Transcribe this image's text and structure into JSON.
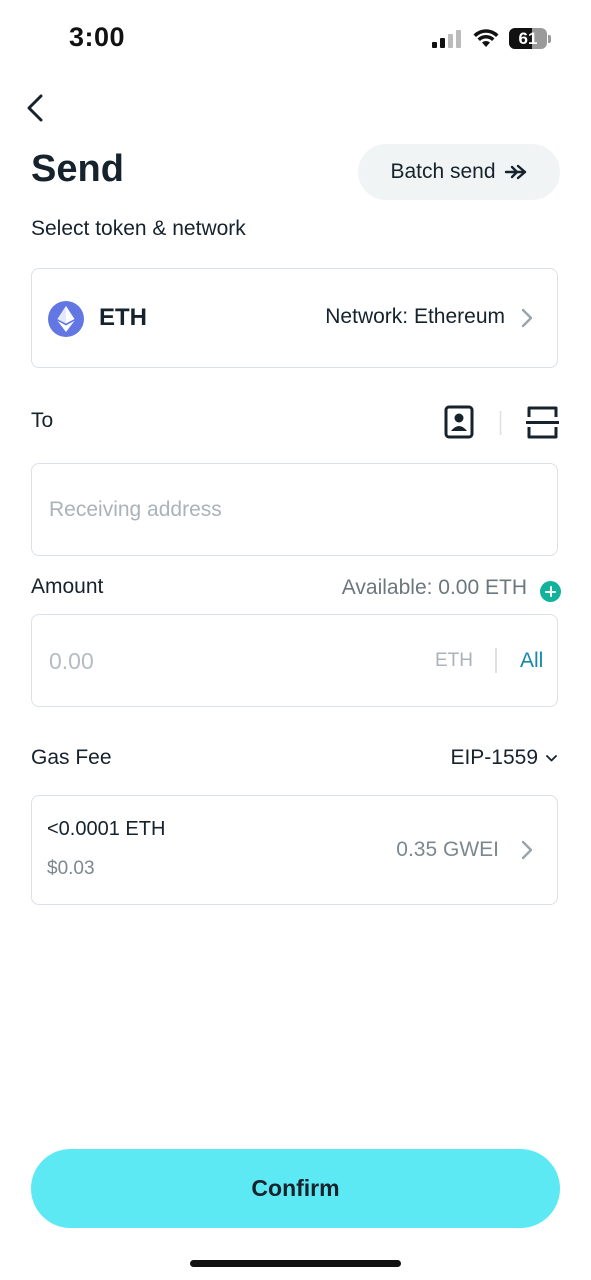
{
  "status_bar": {
    "time": "3:00",
    "battery_percent": "61",
    "battery_level": 0.61
  },
  "header": {
    "title": "Send",
    "batch_send_label": "Batch send"
  },
  "token_section": {
    "label": "Select token & network",
    "token": "ETH",
    "network_text": "Network: Ethereum"
  },
  "to_section": {
    "label": "To",
    "address_placeholder": "Receiving address",
    "address_value": ""
  },
  "amount_section": {
    "label": "Amount",
    "available_text": "Available: 0.00 ETH",
    "placeholder": "0.00",
    "unit": "ETH",
    "all_label": "All"
  },
  "gas_section": {
    "label": "Gas Fee",
    "mode": "EIP-1559",
    "fee_eth": "<0.0001 ETH",
    "fee_usd": "$0.03",
    "gwei": "0.35 GWEI"
  },
  "confirm_label": "Confirm",
  "colors": {
    "accent": "#5de9f3",
    "link": "#1689a7",
    "plus": "#13b29c",
    "eth_icon": "#6277e3",
    "text": "#16222c",
    "placeholder": "#a9b3b8",
    "border": "#dbe1e4"
  },
  "icons": [
    "signal-icon",
    "wifi-icon",
    "battery-icon",
    "back-arrow-icon",
    "double-arrow-icon",
    "eth-logo-icon",
    "chevron-right-icon",
    "contacts-icon",
    "scan-icon",
    "plus-icon",
    "chevron-down-icon"
  ]
}
